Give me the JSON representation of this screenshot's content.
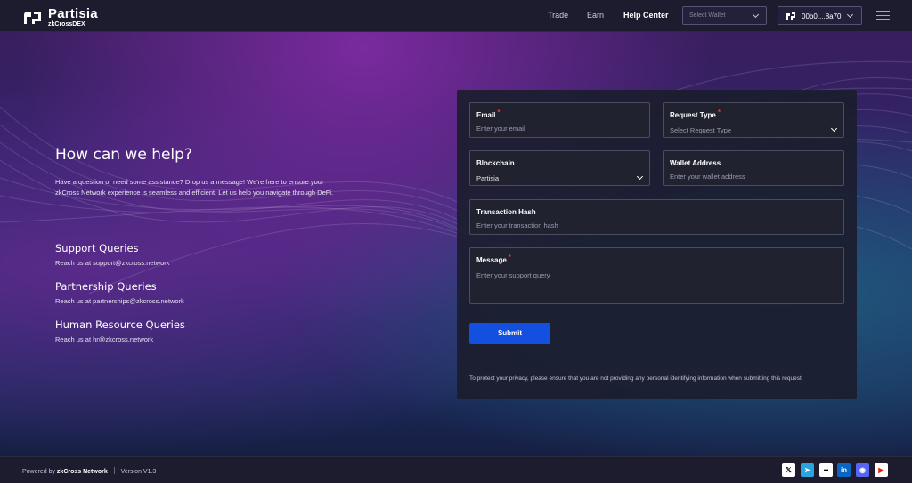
{
  "header": {
    "brand_name": "Partisia",
    "brand_sub": "zkCrossDEX",
    "nav": [
      {
        "label": "Trade",
        "active": false
      },
      {
        "label": "Earn",
        "active": false
      },
      {
        "label": "Help Center",
        "active": true
      }
    ],
    "select_wallet_placeholder": "Select Wallet",
    "wallet_address": "00b0....8a70",
    "menu_icon": "hamburger-icon"
  },
  "help": {
    "title": "How can we help?",
    "description": "Have a question or need some assistance? Drop us a message! We're here to ensure your zkCross Network experience is seamless and efficient. Let us help you navigate through DeFi.",
    "queries": [
      {
        "title": "Support Queries",
        "text": "Reach us at support@zkcross.network"
      },
      {
        "title": "Partnership Queries",
        "text": "Reach us at partnerships@zkcross.network"
      },
      {
        "title": "Human Resource Queries",
        "text": "Reach us at hr@zkcross.network"
      }
    ]
  },
  "form": {
    "email": {
      "label": "Email",
      "placeholder": "Enter your email",
      "required": true
    },
    "request_type": {
      "label": "Request Type",
      "placeholder": "Select Request Type",
      "required": true
    },
    "blockchain": {
      "label": "Blockchain",
      "value": "Partisia"
    },
    "wallet_address": {
      "label": "Wallet Address",
      "placeholder": "Enter your wallet address"
    },
    "transaction_hash": {
      "label": "Transaction Hash",
      "placeholder": "Enter your transaction hash"
    },
    "message": {
      "label": "Message",
      "placeholder": "Enter your support query",
      "required": true
    },
    "required_mark": "*",
    "submit_label": "Submit",
    "privacy_note": "To protect your privacy, please ensure that you are not providing any personal identifying information when submitting this request."
  },
  "footer": {
    "powered_prefix": "Powered by",
    "powered_brand": "zkCross Network",
    "version": "Version V1.3",
    "social": [
      {
        "icon": "x-icon",
        "glyph": "𝕏",
        "bg": "#ffffff",
        "fg": "#000000"
      },
      {
        "icon": "telegram-icon",
        "glyph": "➤",
        "bg": "#2aa3df",
        "fg": "#ffffff"
      },
      {
        "icon": "medium-icon",
        "glyph": "●●",
        "bg": "#ffffff",
        "fg": "#000000"
      },
      {
        "icon": "linkedin-icon",
        "glyph": "in",
        "bg": "#0a66c2",
        "fg": "#ffffff"
      },
      {
        "icon": "discord-icon",
        "glyph": "◉",
        "bg": "#5865f2",
        "fg": "#ffffff"
      },
      {
        "icon": "youtube-icon",
        "glyph": "▶",
        "bg": "#ffffff",
        "fg": "#e62117"
      }
    ]
  },
  "colors": {
    "accent": "#1450e0",
    "required": "#e53935",
    "header_bg": "#1d1b2e"
  }
}
